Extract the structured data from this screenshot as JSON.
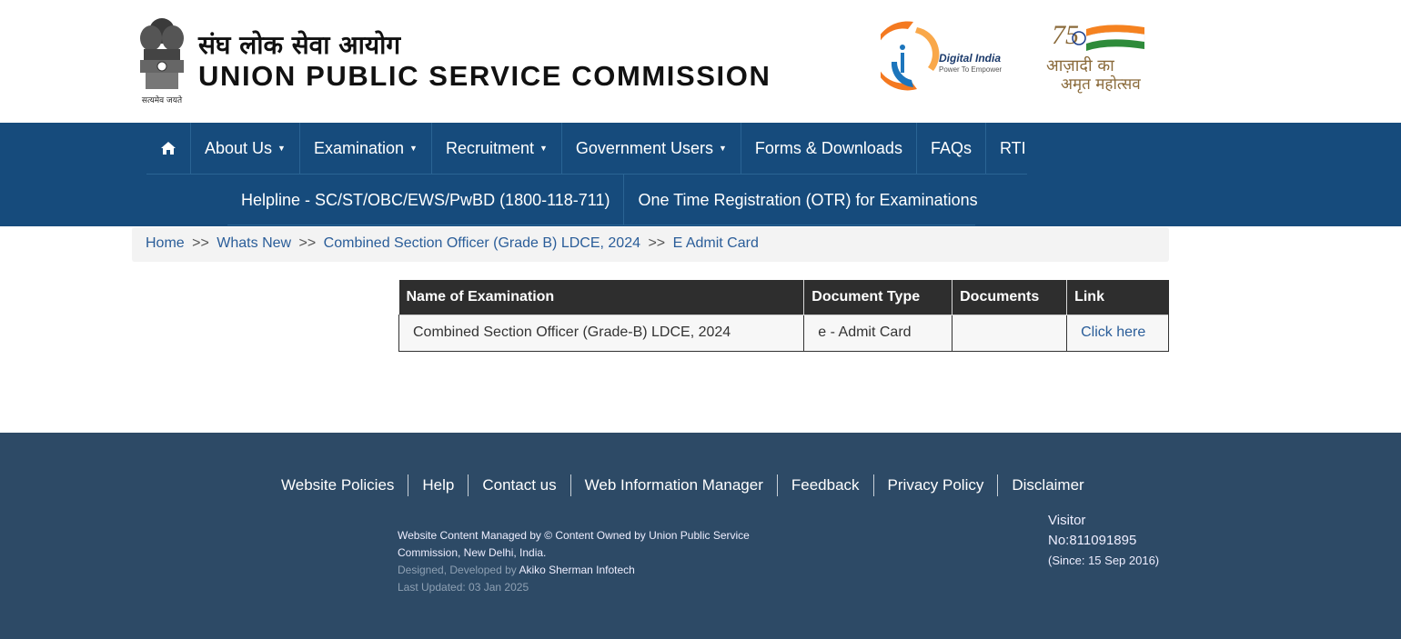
{
  "header": {
    "title_hindi": "संघ लोक सेवा आयोग",
    "title_english": "UNION PUBLIC SERVICE COMMISSION",
    "emblem_motto": "सत्यमेव जयते",
    "digital_india": {
      "title": "Digital India",
      "tagline": "Power To Empower"
    },
    "azadi": {
      "line1": "आज़ादी का",
      "line2": "अमृत महोत्सव",
      "number": "75"
    }
  },
  "nav": {
    "home_icon": "home-icon",
    "row1": [
      {
        "label": "About Us",
        "dropdown": true
      },
      {
        "label": "Examination",
        "dropdown": true
      },
      {
        "label": "Recruitment",
        "dropdown": true
      },
      {
        "label": "Government Users",
        "dropdown": true
      },
      {
        "label": "Forms & Downloads",
        "dropdown": false
      },
      {
        "label": "FAQs",
        "dropdown": false
      },
      {
        "label": "RTI",
        "dropdown": false
      }
    ],
    "row2": [
      {
        "label": "Helpline - SC/ST/OBC/EWS/PwBD (1800-118-711)"
      },
      {
        "label": "One Time Registration (OTR) for Examinations"
      }
    ]
  },
  "breadcrumb": {
    "items": [
      "Home",
      "Whats New",
      "Combined Section Officer (Grade B) LDCE, 2024",
      "E Admit Card"
    ],
    "separator": ">>"
  },
  "table": {
    "headers": [
      "Name of Examination",
      "Document Type",
      "Documents",
      "Link"
    ],
    "rows": [
      {
        "name": "Combined Section Officer (Grade-B) LDCE, 2024",
        "doc_type": "e - Admit Card",
        "documents": "",
        "link": "Click here"
      }
    ]
  },
  "footer": {
    "links": [
      "Website Policies",
      "Help",
      "Contact us",
      "Web Information Manager",
      "Feedback",
      "Privacy Policy",
      "Disclaimer"
    ],
    "info_line1": "Website Content Managed by © Content Owned by Union Public Service",
    "info_line2": "Commission, New Delhi, India.",
    "designed_by_prefix": "Designed, Developed by",
    "designed_by_name": "Akiko Sherman Infotech",
    "last_updated": "Last Updated: 03 Jan 2025",
    "visitor_label": "Visitor",
    "visitor_no": "No:811091895",
    "visitor_since": "(Since: 15 Sep 2016)"
  },
  "colors": {
    "nav_bg": "#164b7c",
    "footer_bg": "#2d4a66",
    "table_header_bg": "#2e2e2e",
    "link": "#2a5d99"
  }
}
